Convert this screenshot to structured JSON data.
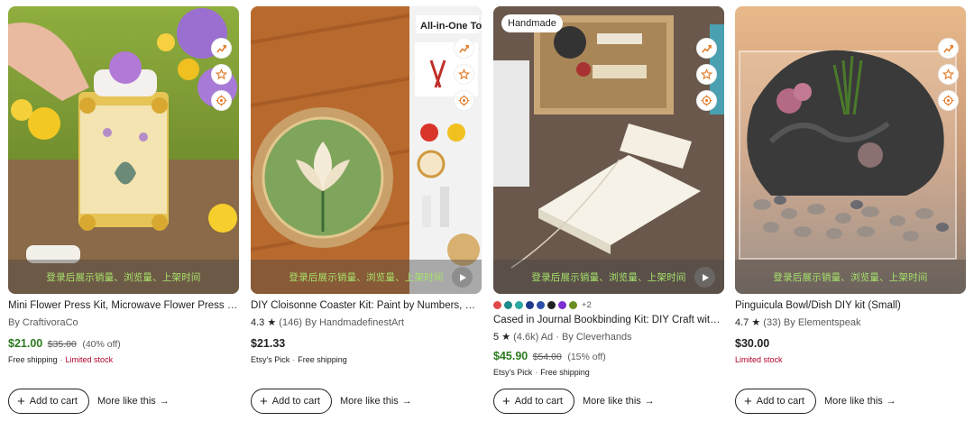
{
  "overlay_text": "登录后展示销量、浏览量、上架时间",
  "actions": {
    "add_to_cart": "Add to cart",
    "more_like_this": "More like this",
    "arrow": "→",
    "plus": "+"
  },
  "side_icons": [
    "chart-icon",
    "star-icon",
    "target-icon"
  ],
  "colors": {
    "sale_price": "#2c7a1f",
    "alert": "#b3002d",
    "overlay_text": "#a6e36a"
  },
  "products": [
    {
      "title": "Mini Flower Press Kit, Microwave Flower Press for Kids, DIY",
      "shop_line": "By CraftivoraCo",
      "price": "$21.00",
      "original_price": "$35.00",
      "discount": "(40% off)",
      "tag_1": "Free shipping",
      "tag_2": "Limited stock",
      "has_video": false
    },
    {
      "title": "DIY Cloisonne Coaster Kit: Paint by Numbers, Beginner Friendly",
      "rating": "4.3",
      "star": "★",
      "reviews": "(146)",
      "shop": "By HandmadefinestArt",
      "price": "$21.33",
      "tag_1": "Etsy's Pick",
      "tag_2": "Free shipping",
      "image_text": "All-in-One Too",
      "has_video": true
    },
    {
      "badge": "Handmade",
      "swatch_colors": [
        "#e04848",
        "#1f8a8a",
        "#2aa8a0",
        "#1d3a8a",
        "#2b4fa8",
        "#222222",
        "#7b2fd0",
        "#6b8e23"
      ],
      "swatch_more": "+2",
      "title": "Cased in Journal Bookbinding Kit: DIY Craft with Tools",
      "rating": "5",
      "star": "★",
      "reviews": "(4.6k)",
      "ad_label": "Ad",
      "shop": "By Cleverhands",
      "price": "$45.90",
      "original_price": "$54.00",
      "discount": "(15% off)",
      "tag_1": "Etsy's Pick",
      "tag_2": "Free shipping",
      "has_video": true
    },
    {
      "title": "Pinguicula Bowl/Dish DIY kit (Small)",
      "rating": "4.7",
      "star": "★",
      "reviews": "(33)",
      "shop": "By Elementspeak",
      "price": "$30.00",
      "tag_1": "Limited stock",
      "has_video": false
    }
  ]
}
